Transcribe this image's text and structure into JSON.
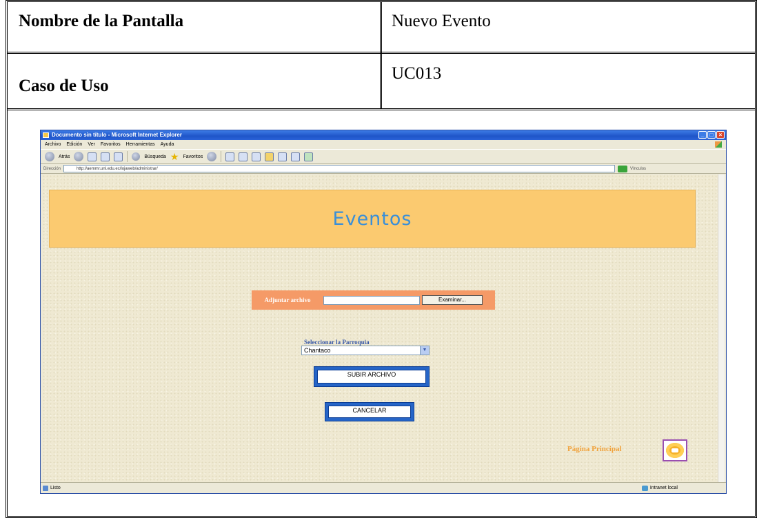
{
  "table": {
    "screen_name_label": "Nombre de la Pantalla",
    "screen_name_value": "Nuevo Evento",
    "use_case_label": "Caso de Uso",
    "use_case_value": "UC013"
  },
  "browser": {
    "title": "Documento sin título - Microsoft Internet Explorer",
    "menu": [
      "Archivo",
      "Edición",
      "Ver",
      "Favoritos",
      "Herramientas",
      "Ayuda"
    ],
    "toolbar": {
      "back": "Atrás",
      "search": "Búsqueda",
      "favorites": "Favoritos"
    },
    "address_label": "Dirección",
    "address": "http://aemmr.unl.edu.ec/lojaweb/administrar/",
    "links_label": "Vínculos",
    "status_text": "Listo",
    "zone_text": "Intranet local"
  },
  "page": {
    "banner_title": "Eventos",
    "attach_label": "Adjuntar archivo",
    "browse_button": "Examinar...",
    "parish_label": "Seleccionar la Parroquia",
    "parish_selected": "Chantaco",
    "upload_button": "SUBIR ARCHIVO",
    "cancel_button": "CANCELAR",
    "main_page_link": "Página Principal"
  }
}
